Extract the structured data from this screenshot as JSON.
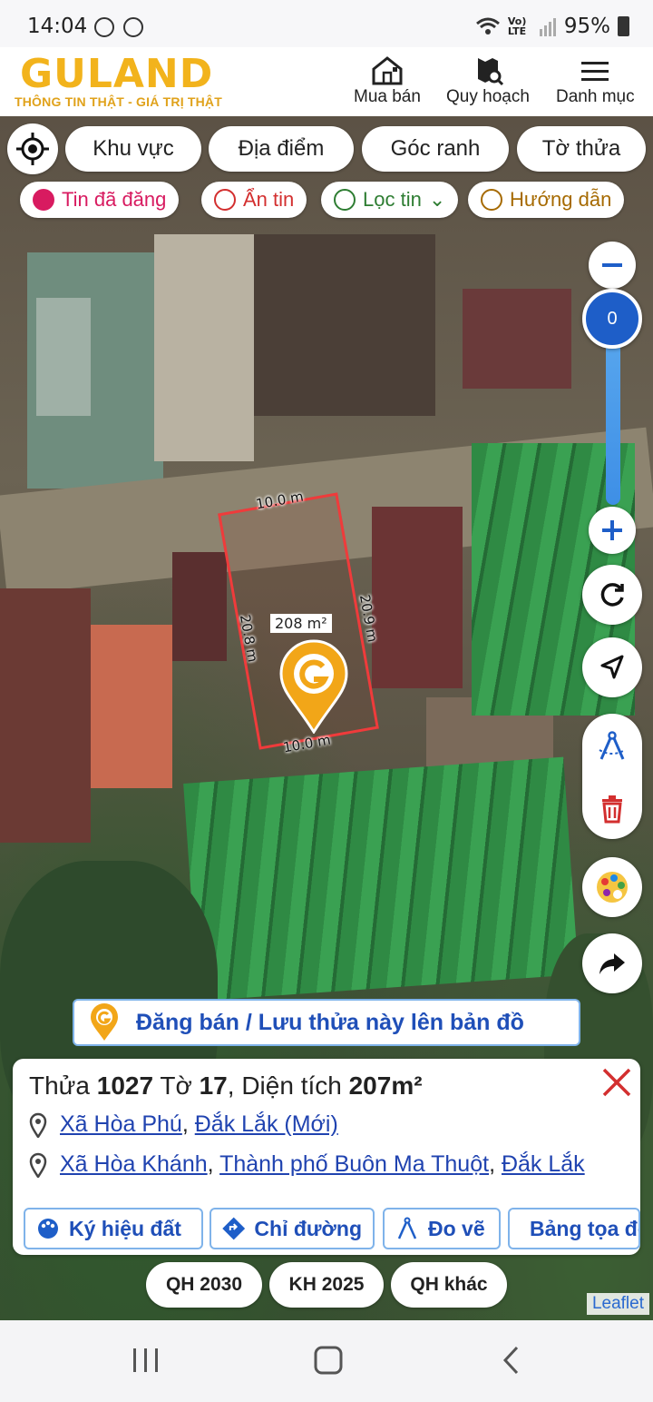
{
  "status_bar": {
    "time": "14:04",
    "network": "Vo) LTE",
    "battery": "95%"
  },
  "header": {
    "brand": "GULAND",
    "tagline": "THÔNG TIN THẬT - GIÁ TRỊ THẬT",
    "nav": [
      {
        "label": "Mua bán",
        "icon": "house-icon"
      },
      {
        "label": "Quy hoạch",
        "icon": "map-search-icon"
      },
      {
        "label": "Danh mục",
        "icon": "menu-icon"
      }
    ]
  },
  "filters": {
    "pills": [
      "Khu vực",
      "Địa điểm",
      "Góc ranh",
      "Tờ thửa"
    ],
    "chips": [
      {
        "label": "Tin đã đăng",
        "color": "#d81b60"
      },
      {
        "label": "Ẩn tin",
        "color": "#d32f2f"
      },
      {
        "label": "Lọc tin",
        "color": "#2e7d32"
      },
      {
        "label": "Hướng dẫn",
        "color": "#a66a00"
      }
    ]
  },
  "map_controls": {
    "zoom_value": "0"
  },
  "plot": {
    "top_edge": "10.0 m",
    "bottom_edge": "10.0 m",
    "left_edge": "20.8 m",
    "right_edge": "20.9 m",
    "area": "208 m²",
    "outline_color": "#ef3b3b"
  },
  "post_bar": {
    "label": "Đăng bán / Lưu thửa này lên bản đồ"
  },
  "info": {
    "title_prefix": "Thửa ",
    "parcel_no": "1027",
    "sheet_prefix": " Tờ ",
    "sheet_no": "17",
    "area_prefix": ", Diện tích ",
    "area": "207m²",
    "address_new": {
      "commune": "Xã Hòa Phú",
      "province": "Đắk Lắk (Mới)"
    },
    "address_old": {
      "commune": "Xã Hòa Khánh",
      "city": "Thành phố Buôn Ma Thuột",
      "province": "Đắk Lắk"
    },
    "actions": [
      "Ký hiệu đất",
      "Chỉ đường",
      "Đo vẽ",
      "Bảng tọa độ"
    ]
  },
  "planning_tabs": [
    "QH 2030",
    "KH 2025",
    "QH khác"
  ],
  "attribution": "Leaflet",
  "colors": {
    "brand": "#f2b31c",
    "link": "#2043b0",
    "accent_blue": "#1e5ec8",
    "danger": "#d32f2f"
  }
}
